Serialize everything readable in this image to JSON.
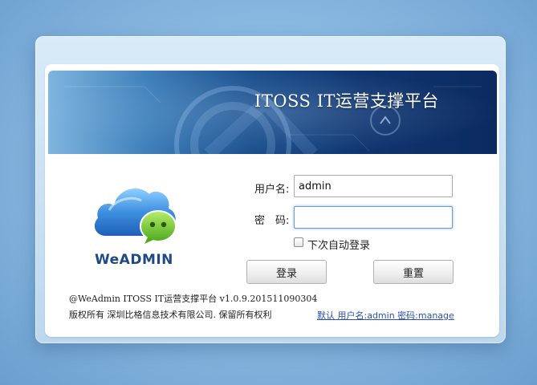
{
  "banner": {
    "title": "ITOSS IT运营支撑平台"
  },
  "logo": {
    "text": "WeADMIN"
  },
  "form": {
    "username_label": "用户名:",
    "username_value": "admin",
    "password_label": "密　码:",
    "password_value": "",
    "auto_login_label": "下次自动登录",
    "login_button": "登录",
    "reset_button": "重置"
  },
  "footer": {
    "version_line": "@WeAdmin ITOSS IT运营支撑平台 v1.0.9.201511090304",
    "copyright_line": "版权所有 深圳比格信息技术有限公司. 保留所有权利",
    "default_account_link": "默认 用户名:admin 密码:manage"
  },
  "colors": {
    "banner_dark": "#0b2a60",
    "logo_text": "#1d4a86",
    "link": "#2a4fb3",
    "cloud_blue": "#3e8fe0",
    "chat_green": "#6cc42e"
  }
}
